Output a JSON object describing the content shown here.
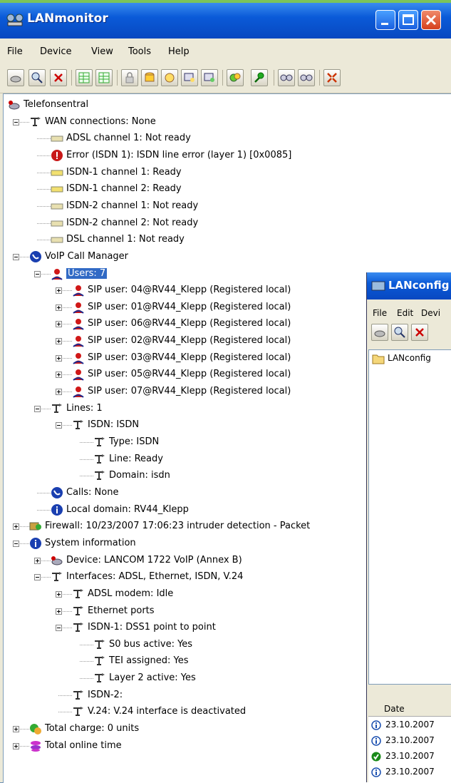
{
  "main_window": {
    "title": "LANmonitor",
    "menu": [
      "File",
      "Device",
      "View",
      "Tools",
      "Help"
    ]
  },
  "tree": {
    "root": "Telefonsentral",
    "wan": {
      "label": "WAN connections: None",
      "items": [
        "ADSL channel 1: Not ready",
        "Error (ISDN 1): ISDN line error (layer 1) [0x0085]",
        "ISDN-1 channel 1: Ready",
        "ISDN-1 channel 2: Ready",
        "ISDN-2 channel 1: Not ready",
        "ISDN-2 channel 2: Not ready",
        "DSL channel 1: Not ready"
      ]
    },
    "voip": {
      "label": "VoIP Call Manager",
      "users_label": "Users: 7",
      "users": [
        "SIP user: 04@RV44_Klepp (Registered local)",
        "SIP user: 01@RV44_Klepp (Registered local)",
        "SIP user: 06@RV44_Klepp (Registered local)",
        "SIP user: 02@RV44_Klepp (Registered local)",
        "SIP user: 03@RV44_Klepp (Registered local)",
        "SIP user: 05@RV44_Klepp (Registered local)",
        "SIP user: 07@RV44_Klepp (Registered local)"
      ],
      "lines_label": "Lines: 1",
      "isdn_label": "ISDN: ISDN",
      "isdn_items": [
        "Type: ISDN",
        "Line: Ready",
        "Domain: isdn"
      ],
      "calls": "Calls: None",
      "local_domain": "Local domain: RV44_Klepp"
    },
    "firewall": "Firewall: 10/23/2007 17:06:23 intruder detection - Packet",
    "sysinfo": {
      "label": "System information",
      "device": "Device: LANCOM 1722 VoIP (Annex B)",
      "interfaces": "Interfaces: ADSL, Ethernet, ISDN, V.24",
      "adsl": "ADSL modem: Idle",
      "ethernet": "Ethernet ports",
      "isdn1": "ISDN-1: DSS1 point to point",
      "isdn1_items": [
        "S0 bus active: Yes",
        "TEI assigned: Yes",
        "Layer 2 active: Yes"
      ],
      "isdn2": "ISDN-2:",
      "v24": "V.24: V.24 interface is deactivated"
    },
    "total_charge": "Total charge: 0 units",
    "total_online": "Total online time"
  },
  "second_window": {
    "title": "LANconfig",
    "menu": [
      "File",
      "Edit",
      "Devi"
    ],
    "tree_root": "LANconfig",
    "column": "Date",
    "rows": [
      "23.10.2007",
      "23.10.2007",
      "23.10.2007",
      "23.10.2007"
    ]
  },
  "colors": {
    "title_bar": "#0a5ad8",
    "selection": "#316ac5",
    "desktop": "#6a8fb5"
  }
}
